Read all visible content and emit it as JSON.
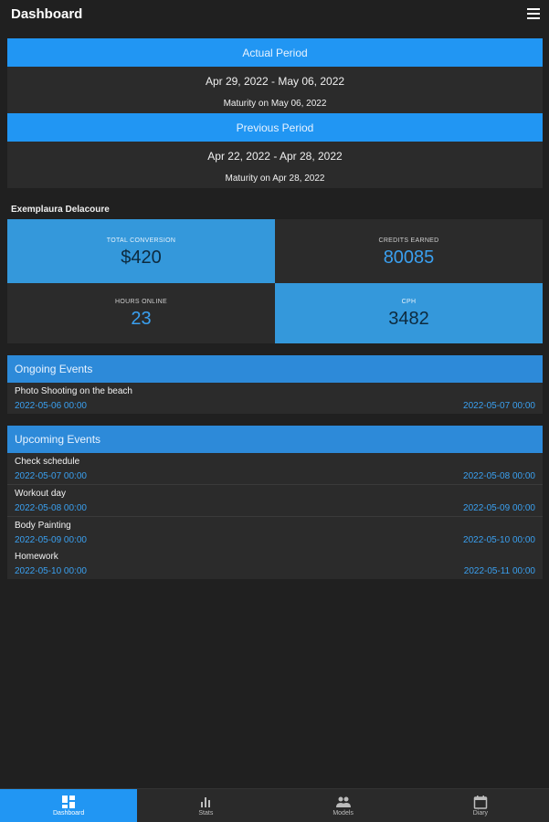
{
  "app": {
    "title": "Dashboard",
    "menu_icon": "hamburger-menu-icon"
  },
  "actual_period": {
    "header": "Actual Period",
    "range": "Apr 29, 2022 - May 06, 2022",
    "maturity": "Maturity on May 06, 2022"
  },
  "previous_period": {
    "header": "Previous Period",
    "range": "Apr 22, 2022 - Apr 28, 2022",
    "maturity": "Maturity on Apr 28, 2022"
  },
  "user": {
    "name": "Exemplaura Delacoure"
  },
  "stats": [
    {
      "label": "Total Conversion",
      "value": "$420"
    },
    {
      "label": "Credits Earned",
      "value": "80085"
    },
    {
      "label": "Hours Online",
      "value": "23"
    },
    {
      "label": "CPH",
      "value": "3482"
    }
  ],
  "ongoing": {
    "header": "Ongoing Events",
    "events": [
      {
        "name": "Photo Shooting on the beach",
        "start": "2022-05-06 00:00",
        "end": "2022-05-07 00:00"
      }
    ]
  },
  "upcoming": {
    "header": "Upcoming Events",
    "events": [
      {
        "name": "Check schedule",
        "start": "2022-05-07 00:00",
        "end": "2022-05-08 00:00"
      },
      {
        "name": "Workout day",
        "start": "2022-05-08 00:00",
        "end": "2022-05-09 00:00"
      },
      {
        "name": "Body Painting",
        "start": "2022-05-09 00:00",
        "end": "2022-05-10 00:00"
      },
      {
        "name": "Homework",
        "start": "2022-05-10 00:00",
        "end": "2022-05-11 00:00"
      }
    ]
  },
  "nav": [
    {
      "label": "Dashboard",
      "icon": "dashboard-icon",
      "active": true
    },
    {
      "label": "Stats",
      "icon": "bar-chart-icon",
      "active": false
    },
    {
      "label": "Models",
      "icon": "people-icon",
      "active": false
    },
    {
      "label": "Diary",
      "icon": "calendar-icon",
      "active": false
    }
  ],
  "colors": {
    "accent": "#2196f3",
    "section": "#2d8ad9",
    "tile_blue": "#3498db",
    "value_blue": "#3aa0f0",
    "background": "#202020",
    "panel": "#2b2b2b"
  }
}
